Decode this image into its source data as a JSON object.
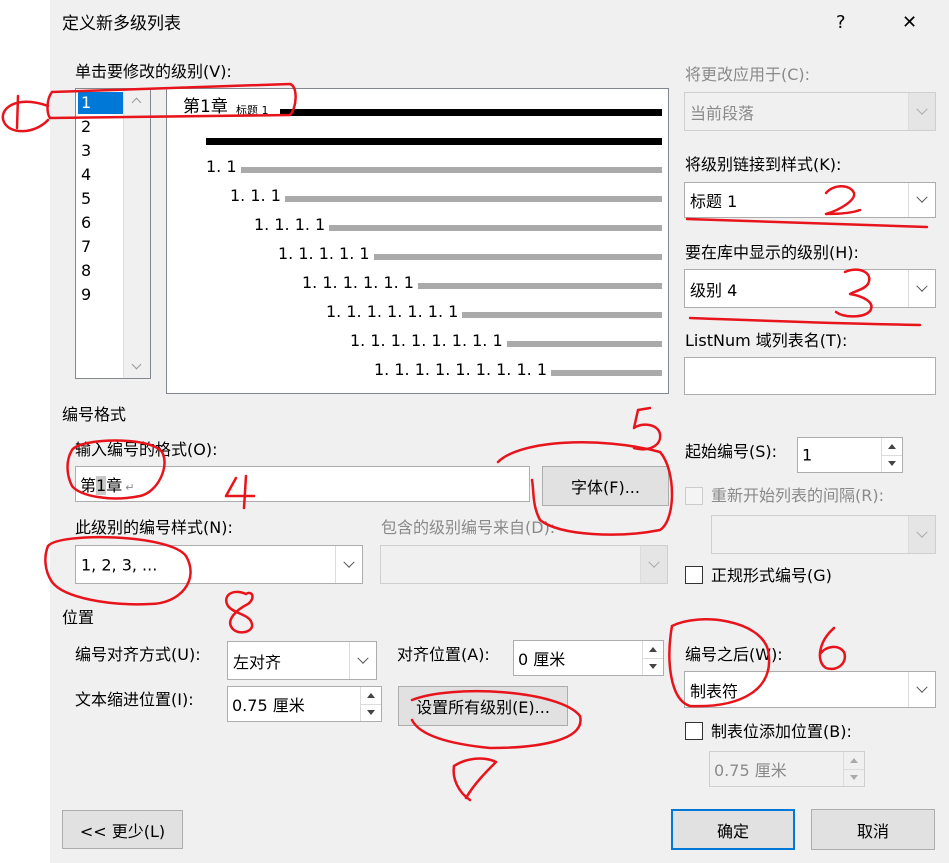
{
  "dialog": {
    "title": "定义新多级列表",
    "help_glyph": "?",
    "close_glyph": "✕"
  },
  "levels": {
    "label": "单击要修改的级别(V):",
    "items": [
      "1",
      "2",
      "3",
      "4",
      "5",
      "6",
      "7",
      "8",
      "9"
    ],
    "selected": "1"
  },
  "preview": {
    "level1_prefix": "第1章",
    "level1_style": "标题 1",
    "rows": [
      "1. 1",
      "1. 1. 1",
      "1. 1. 1. 1",
      "1. 1. 1. 1. 1",
      "1. 1. 1. 1. 1. 1",
      "1. 1. 1. 1. 1. 1. 1",
      "1. 1. 1. 1. 1. 1. 1. 1",
      "1. 1. 1. 1. 1. 1. 1. 1. 1"
    ]
  },
  "apply_to": {
    "label": "将更改应用于(C):",
    "value": "当前段落"
  },
  "link_style": {
    "label": "将级别链接到样式(K):",
    "value": "标题 1"
  },
  "gallery_level": {
    "label": "要在库中显示的级别(H):",
    "value": "级别 4"
  },
  "listnum": {
    "label": "ListNum 域列表名(T):",
    "value": ""
  },
  "number_format": {
    "section_label": "编号格式",
    "format_label": "输入编号的格式(O):",
    "format_value_prefix": "第",
    "format_value_number": "1",
    "format_value_suffix": "章",
    "format_value_mark": "↵",
    "font_button": "字体(F)...",
    "style_label": "此级别的编号样式(N):",
    "style_value": "1, 2, 3, ...",
    "include_label": "包含的级别编号来自(D):",
    "include_value": "",
    "start_label": "起始编号(S):",
    "start_value": "1",
    "restart_label": "重新开始列表的间隔(R):",
    "restart_value": "",
    "legal_label": "正规形式编号(G)"
  },
  "position": {
    "section_label": "位置",
    "align_label": "编号对齐方式(U):",
    "align_value": "左对齐",
    "aligned_at_label": "对齐位置(A):",
    "aligned_at_value": "0 厘米",
    "indent_label": "文本缩进位置(I):",
    "indent_value": "0.75 厘米",
    "set_all_button": "设置所有级别(E)...",
    "follow_label": "编号之后(W):",
    "follow_value": "制表符",
    "tab_add_label": "制表位添加位置(B):",
    "tab_add_value": "0.75 厘米"
  },
  "footer": {
    "less_button": "<< 更少(L)",
    "ok_button": "确定",
    "cancel_button": "取消"
  },
  "colors": {
    "dialog_bg": "#f0f0f0",
    "selection": "#0078d7",
    "annotation": "#e8141c"
  }
}
